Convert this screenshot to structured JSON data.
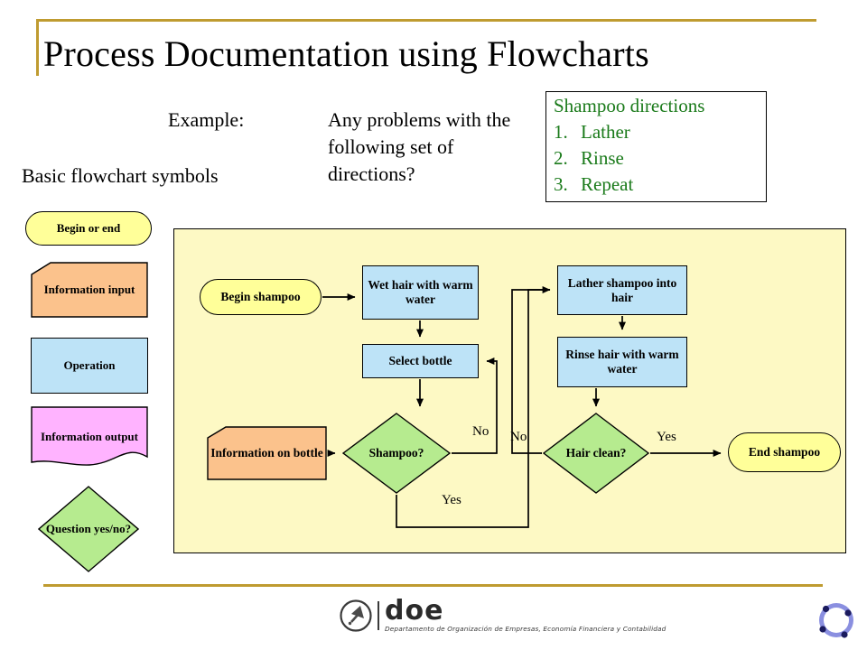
{
  "slide": {
    "title": "Process Documentation using Flowcharts",
    "example_label": "Example:",
    "basic_symbols_label": "Basic flowchart symbols",
    "problem_text": "Any problems with the following set of directions?"
  },
  "directions_box": {
    "heading": "Shampoo directions",
    "items": [
      {
        "num": "1.",
        "text": "Lather"
      },
      {
        "num": "2.",
        "text": "Rinse"
      },
      {
        "num": "3.",
        "text": "Repeat"
      }
    ],
    "text_color": "#1a7a1a"
  },
  "legend": {
    "items": [
      {
        "label": "Begin or end",
        "shape": "terminator-rounded",
        "fill": "#ffff99"
      },
      {
        "label": "Information input",
        "shape": "input-parallelogram-skew",
        "fill": "#fbc28c"
      },
      {
        "label": "Operation",
        "shape": "process-rectangle",
        "fill": "#bde3f7"
      },
      {
        "label": "Information output",
        "shape": "document-wave",
        "fill": "#ffb3ff"
      },
      {
        "label": "Question yes/no?",
        "shape": "decision-diamond",
        "fill": "#b6eb8f"
      }
    ]
  },
  "flowchart": {
    "nodes": [
      {
        "id": "begin",
        "label": "Begin shampoo",
        "shape": "terminator-rounded",
        "fill": "#ffff99"
      },
      {
        "id": "wet",
        "label": "Wet hair with warm water",
        "shape": "process-rectangle",
        "fill": "#bde3f7"
      },
      {
        "id": "select",
        "label": "Select bottle",
        "shape": "process-rectangle",
        "fill": "#bde3f7"
      },
      {
        "id": "infobottle",
        "label": "Information on bottle",
        "shape": "input-parallelogram-skew",
        "fill": "#fbc28c"
      },
      {
        "id": "shampoo",
        "label": "Shampoo?",
        "shape": "decision-diamond",
        "fill": "#b6eb8f"
      },
      {
        "id": "lather",
        "label": "Lather shampoo into hair",
        "shape": "process-rectangle",
        "fill": "#bde3f7"
      },
      {
        "id": "rinse",
        "label": "Rinse hair with warm water",
        "shape": "process-rectangle",
        "fill": "#bde3f7"
      },
      {
        "id": "hairclean",
        "label": "Hair clean?",
        "shape": "decision-diamond",
        "fill": "#b6eb8f"
      },
      {
        "id": "end",
        "label": "End shampoo",
        "shape": "terminator-rounded",
        "fill": "#ffff99"
      }
    ],
    "edge_labels": {
      "shampoo_no": "No",
      "shampoo_yes": "Yes",
      "hairclean_no": "No",
      "hairclean_yes": "Yes"
    },
    "canvas_fill": "#fdf9c4"
  },
  "footer": {
    "logo_word": "doe",
    "logo_subtitle": "Departamento de Organización de Empresas, Economía Financiera y Contabilidad"
  },
  "theme": {
    "rule_color": "#bf9b30",
    "corner_logo_color": "#8a8fe0"
  }
}
